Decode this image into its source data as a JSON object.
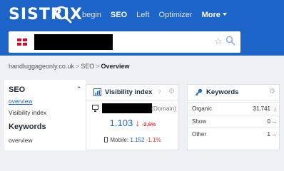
{
  "header": {
    "logo": "SISTRIX",
    "nav": [
      {
        "label": "begin",
        "active": false
      },
      {
        "label": "SEO",
        "active": true
      },
      {
        "label": "Left",
        "active": false
      },
      {
        "label": "Optimizer",
        "active": false
      },
      {
        "label": "More",
        "active": false
      }
    ]
  },
  "search": {
    "country": "flag-uk-icon",
    "query_redacted": true
  },
  "breadcrumb": {
    "domain": "handluggageonly.co.uk",
    "section": "SEO",
    "current": "Overview"
  },
  "sidebar": {
    "section_title": "SEO",
    "items": [
      "overview",
      "Visibility index"
    ],
    "active_item": "overview",
    "section2_title": "Keywords",
    "items2": [
      "overview"
    ]
  },
  "visibility_card": {
    "title": "Visibility index",
    "help": "?",
    "domain_label": "(Domain)",
    "value": "1.103",
    "change": "-2.6%",
    "mobile_label": "Mobile:",
    "mobile_value": "1.152",
    "mobile_change": "-1.1%"
  },
  "keywords_card": {
    "title": "Keywords",
    "rows": [
      {
        "label": "Organic",
        "value": "31,741",
        "trend": "down"
      },
      {
        "label": "Show",
        "value": "0",
        "trend": "right"
      },
      {
        "label": "Other",
        "value": "1",
        "trend": "right"
      }
    ]
  },
  "colors": {
    "brand_blue": "#1c64c8",
    "negative_red": "#d9342b",
    "background": "#eef0f3"
  }
}
